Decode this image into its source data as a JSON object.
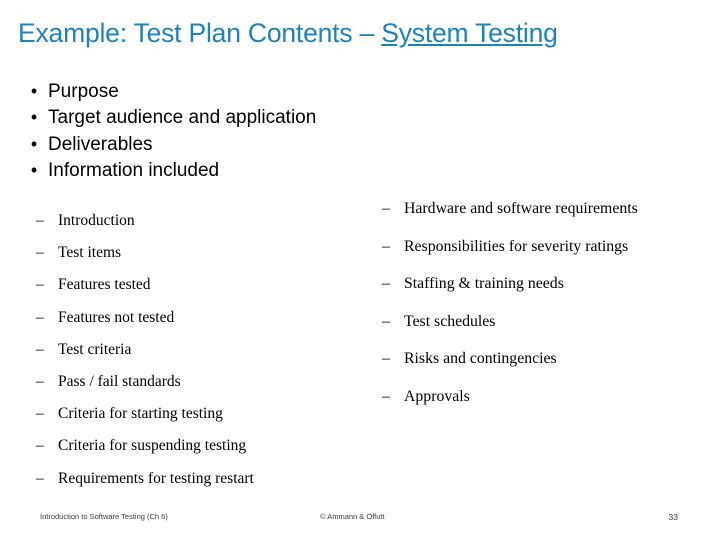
{
  "slide": {
    "title_main": "Example: Test Plan Contents – ",
    "title_underlined": "System Testing",
    "title_color": "#1F82BE",
    "main_bullets": [
      {
        "mark": "•",
        "label": "Purpose"
      },
      {
        "mark": "•",
        "label": "Target audience and application"
      },
      {
        "mark": "•",
        "label": "Deliverables"
      },
      {
        "mark": "•",
        "label": "Information included"
      }
    ],
    "sub_bullets_left": [
      {
        "mark": "–",
        "label": "Introduction"
      },
      {
        "mark": "–",
        "label": "Test items"
      },
      {
        "mark": "–",
        "label": "Features tested"
      },
      {
        "mark": "–",
        "label": "Features not tested"
      },
      {
        "mark": "–",
        "label": "Test criteria"
      },
      {
        "mark": "–",
        "label": "Pass / fail standards"
      },
      {
        "mark": "–",
        "label": "Criteria for starting testing"
      },
      {
        "mark": "–",
        "label": "Criteria for suspending testing"
      },
      {
        "mark": "–",
        "label": "Requirements for testing restart"
      }
    ],
    "sub_bullets_right": [
      {
        "mark": "–",
        "label": "Hardware and software requirements"
      },
      {
        "mark": "–",
        "label": "Responsibilities for severity ratings"
      },
      {
        "mark": "–",
        "label": "Staffing & training needs"
      },
      {
        "mark": "–",
        "label": "Test schedules"
      },
      {
        "mark": "–",
        "label": "Risks and contingencies"
      },
      {
        "mark": "–",
        "label": "Approvals"
      }
    ],
    "footer": {
      "left": "Introduction to Software Testing (Ch 6)",
      "center": "© Ammann & Offutt",
      "right": "33"
    }
  }
}
